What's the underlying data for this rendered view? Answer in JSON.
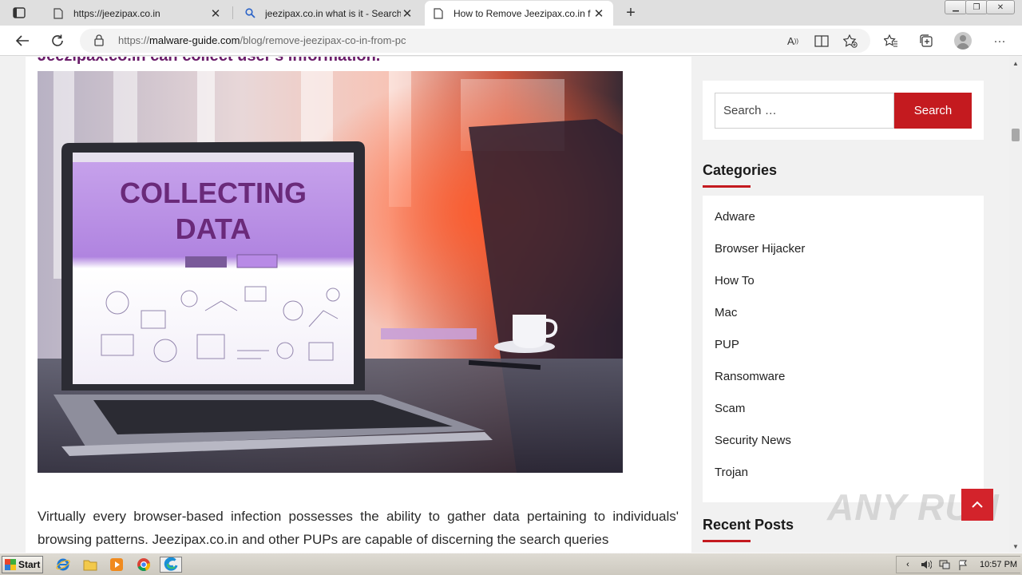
{
  "browser": {
    "tabs": [
      {
        "title": "https://jeezipax.co.in",
        "favicon": "page-icon",
        "active": false
      },
      {
        "title": "jeezipax.co.in what is it - Search",
        "favicon": "search-icon",
        "active": false
      },
      {
        "title": "How to Remove Jeezipax.co.in f",
        "favicon": "page-icon",
        "active": true
      }
    ],
    "address": {
      "scheme": "https://",
      "host": "malware-guide.com",
      "path": "/blog/remove-jeezipax-co-in-from-pc"
    }
  },
  "article": {
    "cut_heading": "Jeezipax.co.in can collect user's information.",
    "hero": {
      "screen_line1": "COLLECTING",
      "screen_line2": "DATA"
    },
    "body": "Virtually every browser-based infection possesses the ability to gather data pertaining to individuals' browsing patterns. Jeezipax.co.in and other PUPs are capable of discerning the search queries"
  },
  "sidebar": {
    "search": {
      "placeholder": "Search …",
      "button": "Search"
    },
    "categories_title": "Categories",
    "categories": [
      "Adware",
      "Browser Hijacker",
      "How To",
      "Mac",
      "PUP",
      "Ransomware",
      "Scam",
      "Security News",
      "Trojan"
    ],
    "recent_title": "Recent Posts"
  },
  "watermark": "ANY RUN",
  "taskbar": {
    "start": "Start",
    "clock": "10:57 PM"
  },
  "colors": {
    "accent": "#c41a1f",
    "heading": "#6a1d6a",
    "back_to_top": "#d3232b"
  }
}
